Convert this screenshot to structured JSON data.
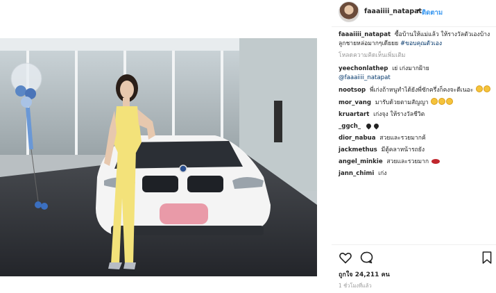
{
  "post": {
    "username": "faaaiiii_natapat",
    "follow_label": "ติดตาม",
    "separator": "•"
  },
  "photo": {
    "plate_color": "#e99aa8",
    "dress_color": "#f3e27a",
    "car_color": "#f4f4f4"
  },
  "caption": {
    "username": "faaaiiii_natapat",
    "text": "ซื้อบ้านให้แม่แล้ว ให้รางวัลตัวเองบ้าง ลูกชายหล่อมากๆเดียยย",
    "hashtag": "#ขอบคุณตัวเอง"
  },
  "load_more_label": "โหลดความคิดเห็นเพิ่มเติม",
  "comments": [
    {
      "username": "yeechonlathep",
      "text": "เย่ เก่งมากฝ้าย",
      "mention": "@faaaiiii_natapat"
    },
    {
      "username": "nootsop",
      "text": "พี่เก่งถ้าหนูทำได้ยังพี่ซักครึ่งก็คงจะดีเนอะ",
      "emoji": "face-2"
    },
    {
      "username": "mor_vang",
      "text": "มารับด้วยตามสัญญา",
      "emoji": "face-3"
    },
    {
      "username": "kruartart",
      "text": "เก่งจุง ให้รางวัลชีวิต"
    },
    {
      "username": "_ggch_",
      "text": "",
      "emoji": "black-heart-2"
    },
    {
      "username": "dior_nabua",
      "text": "สวยและรวยมากค้"
    },
    {
      "username": "jackmethus",
      "text": "มีตู้คลาหน้ารถยัง"
    },
    {
      "username": "angel_minkie",
      "text": "สวยและรวยมาก",
      "emoji": "lips"
    },
    {
      "username": "jann_chimi",
      "text": "เก่ง"
    }
  ],
  "actions": {
    "like_icon": "heart-icon",
    "comment_icon": "comment-icon",
    "save_icon": "bookmark-icon"
  },
  "likes_label": "ถูกใจ 24,211 คน",
  "time_label": "1 ชั่วโมงที่แล้ว"
}
